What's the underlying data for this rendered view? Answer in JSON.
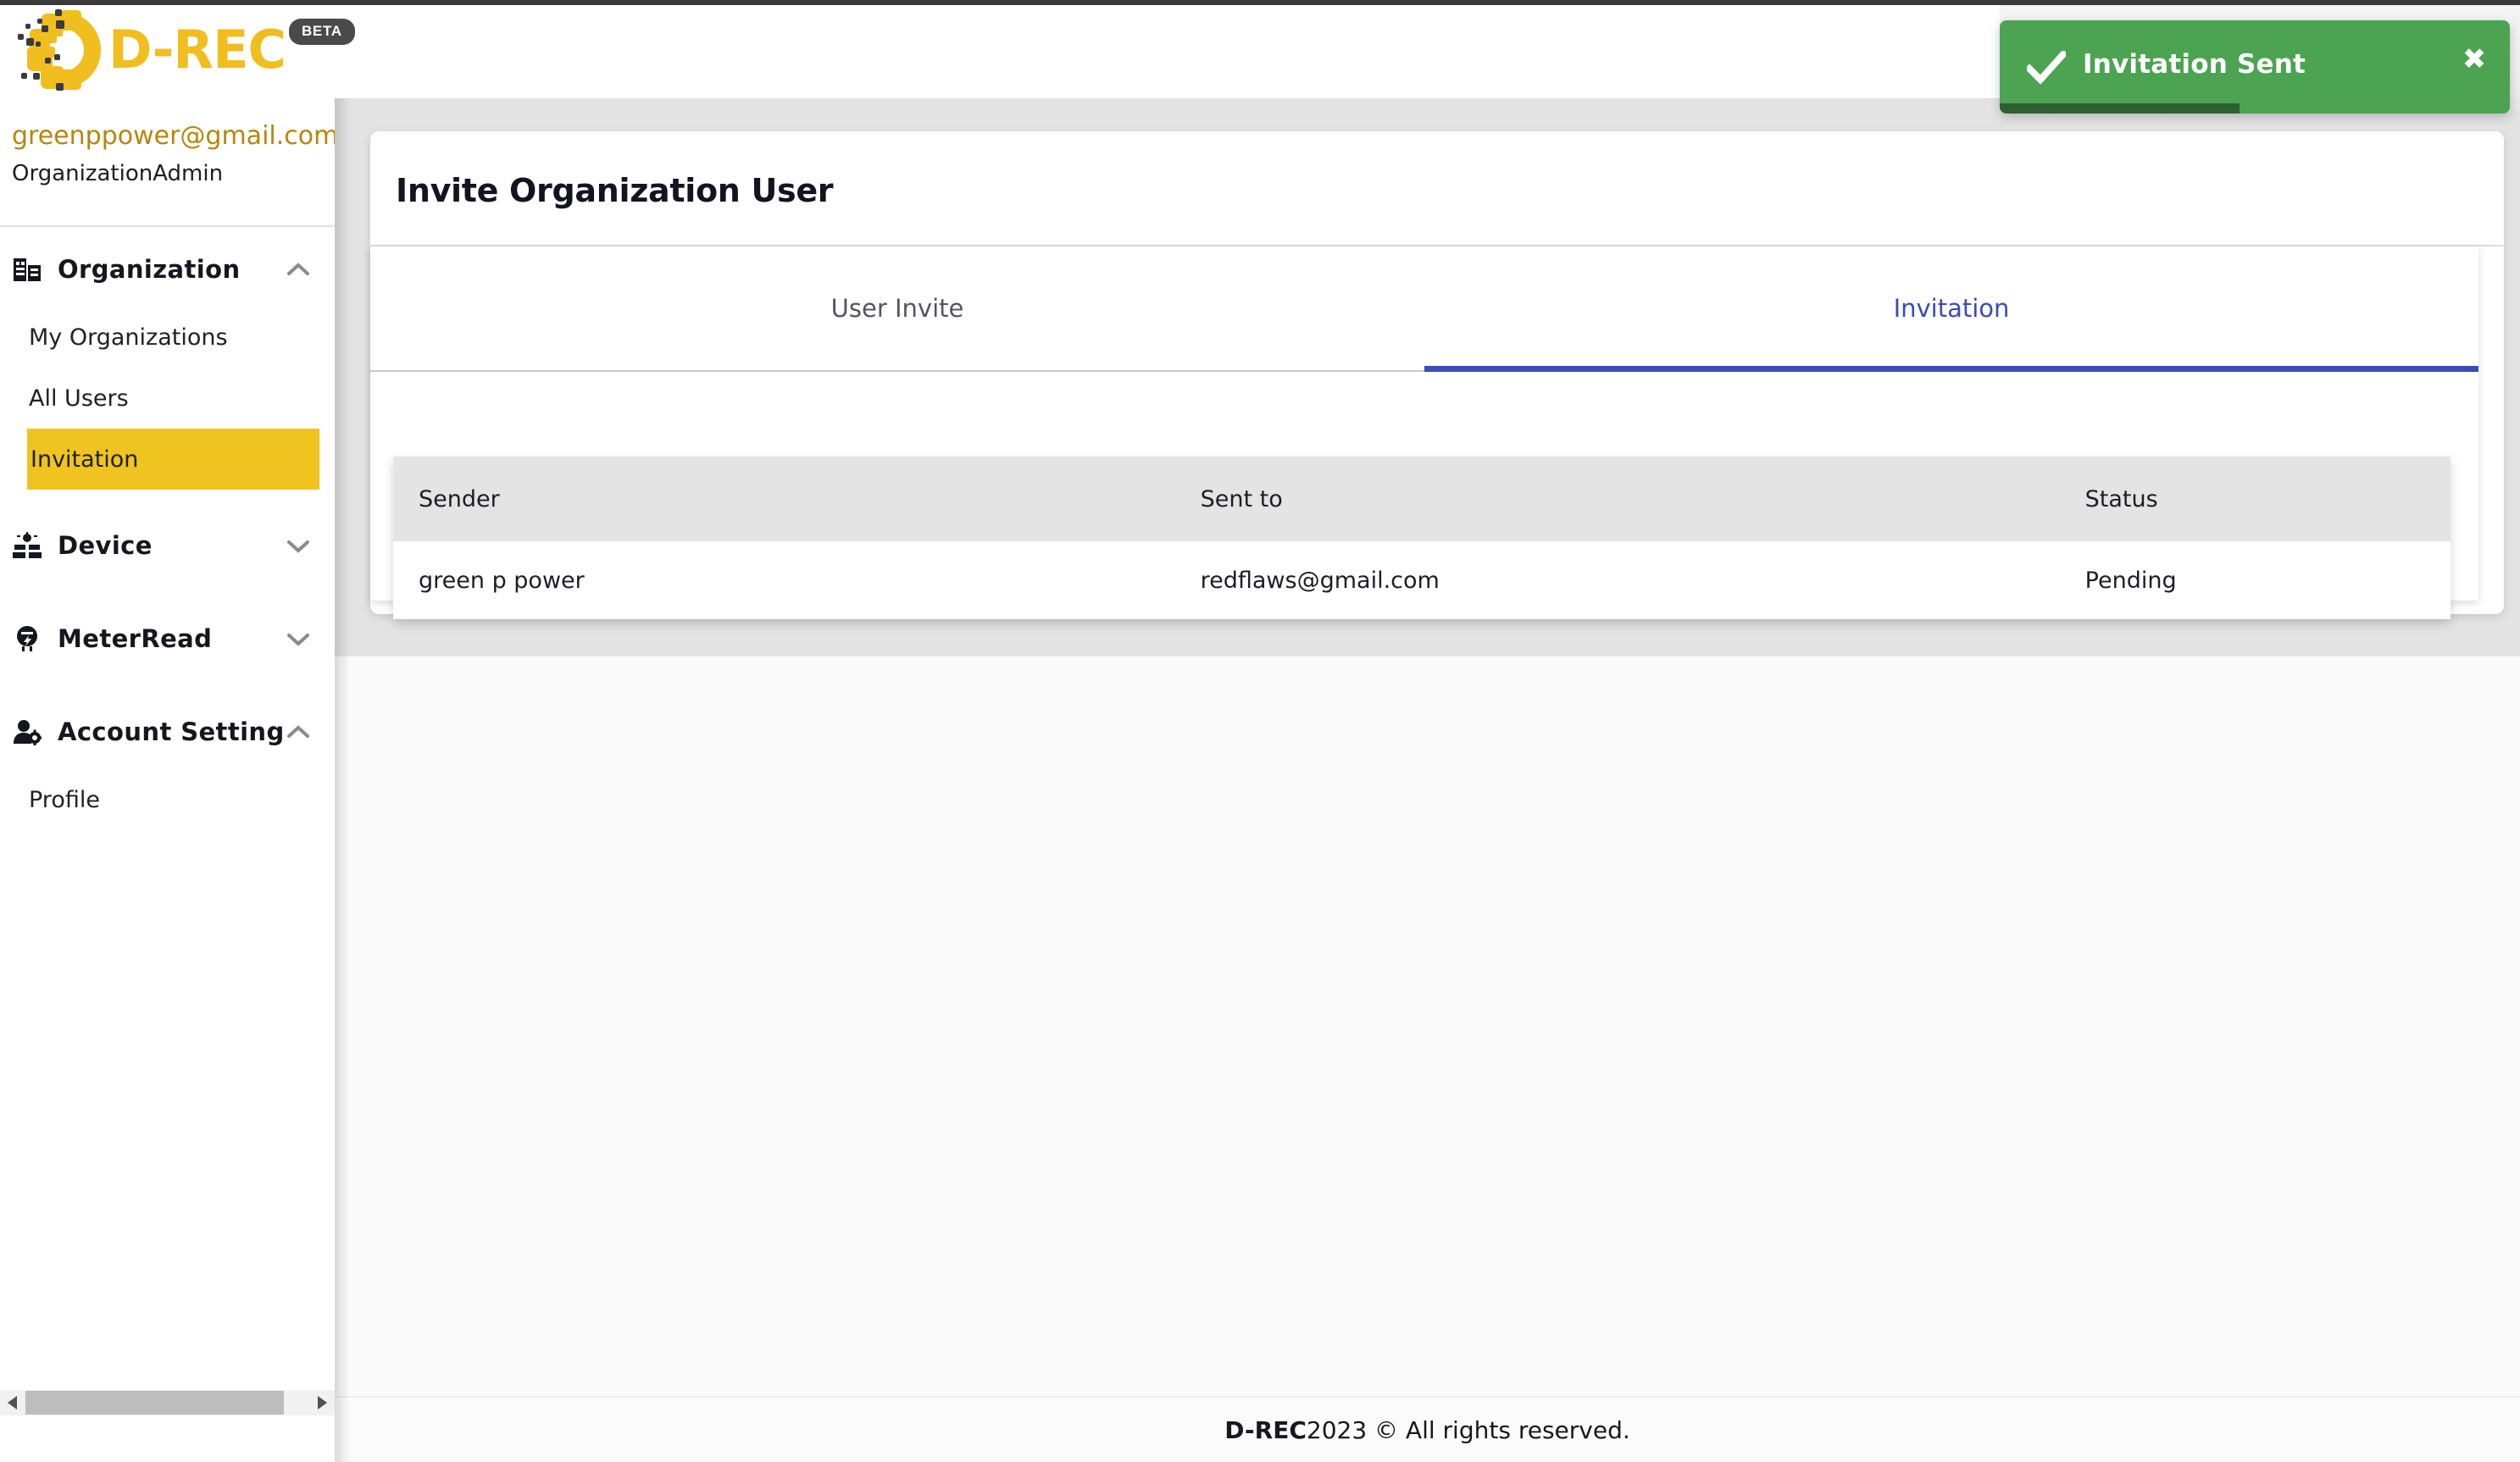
{
  "brand": {
    "logo_icon": "drec-logo-icon",
    "name": "D-REC",
    "badge": "BETA",
    "accent_yellow": "#F0BE1E",
    "badge_bg": "#4a4a4a"
  },
  "sidebar": {
    "user": {
      "email": "greenppower@gmail.com",
      "role": "OrganizationAdmin",
      "email_color": "#B8860B"
    },
    "active_item_bg": "#F0C420",
    "groups": [
      {
        "label": "Organization",
        "icon": "organization-building-icon",
        "chevron": "chevron-up-icon",
        "expanded": true,
        "items": [
          {
            "label": "My Organizations",
            "active": false
          },
          {
            "label": "All Users",
            "active": false
          },
          {
            "label": "Invitation",
            "active": true
          }
        ]
      },
      {
        "label": "Device",
        "icon": "solar-panel-icon",
        "chevron": "chevron-down-icon",
        "expanded": false,
        "items": []
      },
      {
        "label": "MeterRead",
        "icon": "electric-meter-icon",
        "chevron": "chevron-down-icon",
        "expanded": false,
        "items": []
      },
      {
        "label": "Account Setting",
        "icon": "user-gear-icon",
        "chevron": "chevron-up-icon",
        "expanded": true,
        "items": [
          {
            "label": "Profile",
            "active": false
          }
        ]
      }
    ],
    "scrollbar": {
      "left_arrow_icon": "triangle-left-icon",
      "right_arrow_icon": "triangle-right-icon"
    }
  },
  "main": {
    "page_title": "Invite Organization User",
    "tabs": [
      {
        "label": "User Invite",
        "active": false
      },
      {
        "label": "Invitation",
        "active": true
      }
    ],
    "active_tab_color": "#3b4cb8",
    "table": {
      "columns": [
        "Sender",
        "Sent to",
        "Status"
      ],
      "rows": [
        {
          "sender": "green p power",
          "sent_to": "redflaws@gmail.com",
          "status": "Pending"
        }
      ]
    }
  },
  "toast": {
    "icon": "check-icon",
    "message": "Invitation Sent",
    "close_icon": "close-icon",
    "bg": "#4CA351",
    "progress_bg": "#2D5F32",
    "progress_percent": "47"
  },
  "footer": {
    "brand": "D-REC",
    "text": " 2023 © All rights reserved."
  }
}
